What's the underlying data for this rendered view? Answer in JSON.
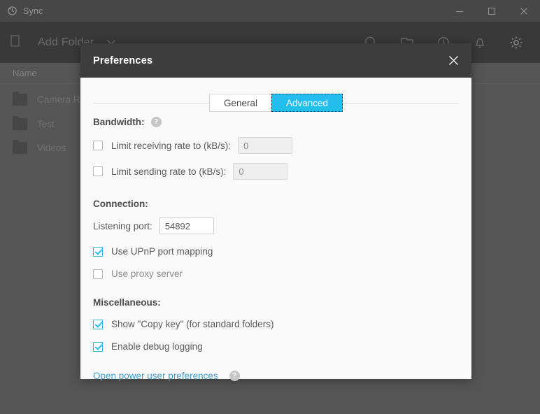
{
  "window": {
    "title": "Sync",
    "app_icon": "sync-icon",
    "controls": {
      "minimize": "minimize-icon",
      "maximize": "maximize-icon",
      "close": "close-icon"
    }
  },
  "toolbar": {
    "add_folder_label": "Add Folder",
    "add_folder_icon": "folder-icon",
    "dropdown_icon": "chevron-down-icon",
    "icons": [
      {
        "name": "search-icon"
      },
      {
        "name": "add-linked-folder-icon"
      },
      {
        "name": "history-clock-icon"
      },
      {
        "name": "notifications-bell-icon"
      },
      {
        "name": "gear-icon"
      }
    ]
  },
  "file_list": {
    "columns": [
      "Name"
    ],
    "rows": [
      {
        "name": "Camera Roll"
      },
      {
        "name": "Test"
      },
      {
        "name": "Videos"
      }
    ]
  },
  "dialog": {
    "title": "Preferences",
    "close_icon": "close-icon",
    "tabs": [
      {
        "label": "General",
        "active": false
      },
      {
        "label": "Advanced",
        "active": true
      }
    ],
    "bandwidth": {
      "heading": "Bandwidth:",
      "help_icon": "help-icon",
      "help_glyph": "?",
      "limit_receiving": {
        "label": "Limit receiving rate to (kB/s):",
        "checked": false,
        "value": "0",
        "disabled": true
      },
      "limit_sending": {
        "label": "Limit sending rate to (kB/s):",
        "checked": false,
        "value": "0",
        "disabled": true
      }
    },
    "connection": {
      "heading": "Connection:",
      "listening_port": {
        "label": "Listening port:",
        "value": "54892"
      },
      "use_upnp": {
        "label": "Use UPnP port mapping",
        "checked": true
      },
      "use_proxy": {
        "label": "Use proxy server",
        "checked": false
      }
    },
    "miscellaneous": {
      "heading": "Miscellaneous:",
      "show_copy_key": {
        "label": "Show \"Copy key\" (for standard folders)",
        "checked": true
      },
      "enable_debug_logging": {
        "label": "Enable debug logging",
        "checked": true
      },
      "power_user_link": {
        "label": "Open power user preferences",
        "help_glyph": "?"
      }
    }
  },
  "colors": {
    "accent": "#25bdf0",
    "link": "#3f9dc9",
    "titlebar": "#3c3c3c",
    "toolbar": "#1d1d1d",
    "dialog_titlebar": "#3d3d3d",
    "dialog_bg": "#fafafa"
  }
}
